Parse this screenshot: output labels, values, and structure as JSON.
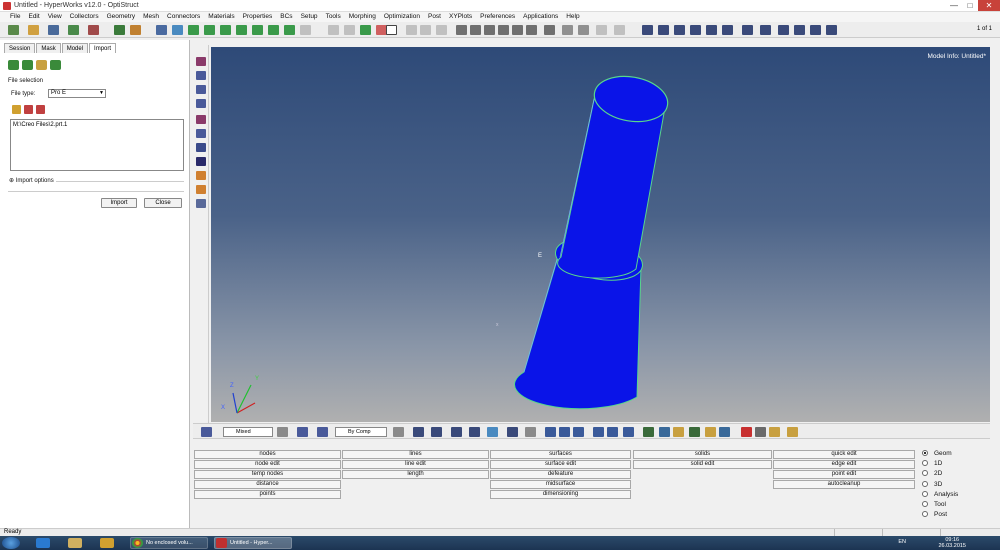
{
  "window": {
    "title": "Untitled - HyperWorks v12.0 - OptiStruct",
    "controls": [
      "—",
      "□",
      "✕"
    ]
  },
  "menu": [
    "File",
    "Edit",
    "View",
    "Collectors",
    "Geometry",
    "Mesh",
    "Connectors",
    "Materials",
    "Properties",
    "BCs",
    "Setup",
    "Tools",
    "Morphing",
    "Optimization",
    "Post",
    "XYPlots",
    "Preferences",
    "Applications",
    "Help"
  ],
  "page_indicator": "1 of 1",
  "left_panel": {
    "tabs": [
      "Session",
      "Mask",
      "Model",
      "Import"
    ],
    "active_tab": "Import",
    "file_selection_label": "File selection",
    "file_type_label": "File type:",
    "file_type_value": "Pro E",
    "file_path": "M:\\Creo Files\\2.prt.1",
    "import_options_label": "Import options",
    "import_button": "Import",
    "close_button": "Close"
  },
  "viewport": {
    "model_info": "Model Info: Untitled*",
    "axes": {
      "x": "X",
      "y": "Y",
      "z": "Z"
    }
  },
  "bottom_toolbar": {
    "display_mode": "Mixed",
    "color_mode": "By Comp"
  },
  "panels": {
    "col1": [
      "nodes",
      "node edit",
      "temp nodes",
      "distance",
      "points"
    ],
    "col2": [
      "lines",
      "line edit",
      "length"
    ],
    "col3": [
      "surfaces",
      "surface edit",
      "defeature",
      "midsurface",
      "dimensioning"
    ],
    "col4": [
      "solids",
      "solid edit"
    ],
    "col5": [
      "quick edit",
      "edge edit",
      "point edit",
      "autocleanup"
    ]
  },
  "page_selector": {
    "options": [
      "Geom",
      "1D",
      "2D",
      "3D",
      "Analysis",
      "Tool",
      "Post"
    ],
    "selected": "Geom"
  },
  "status": {
    "ready": "Ready"
  },
  "taskbar": {
    "apps": [
      {
        "label": "No enclosed volu..."
      },
      {
        "label": "Untitled - Hyper..."
      }
    ],
    "language": "EN",
    "time": "09:16",
    "date": "26.03.2015"
  },
  "colors": {
    "part_fill": "#0a14e8",
    "edge": "#58d68d",
    "viewport_top": "#2e4a78",
    "viewport_bottom": "#b0b0b0"
  }
}
